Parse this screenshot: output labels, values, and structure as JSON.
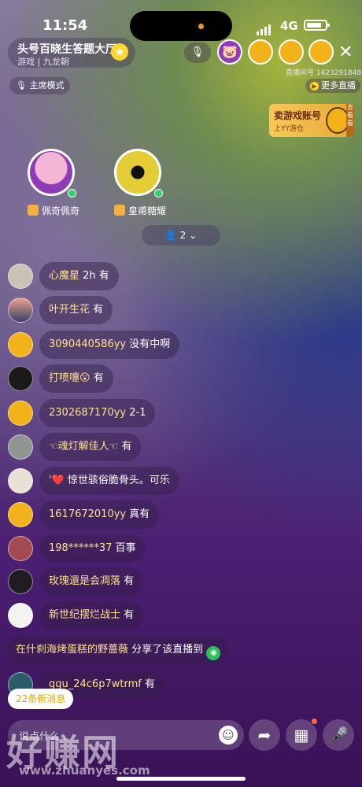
{
  "status_bar": {
    "time": "11:54",
    "network": "4G"
  },
  "room": {
    "title": "头号百晓生答题大厅",
    "subtitle": "游戏 | 九龙朝",
    "room_id": "直播间号 1423291848",
    "more_live": "更多直播",
    "host_mode": "主席模式"
  },
  "promo": {
    "title": "卖游戏账号",
    "subtitle": "上YY游仓",
    "side": "去看看"
  },
  "seats": [
    {
      "name": "佩奇佩奇"
    },
    {
      "name": "皇甫糖耀"
    }
  ],
  "audience_count": "2",
  "messages": [
    {
      "name": "心魔星",
      "text": "2h 有"
    },
    {
      "name": "叶开生花",
      "text": "有"
    },
    {
      "name": "3090440586yy",
      "text": "没有中啊"
    },
    {
      "name": "打喷嚏😮",
      "text": "有"
    },
    {
      "name": "2302687170yy",
      "text": "2-1"
    },
    {
      "name": "☜魂灯解佳人☜",
      "text": "有"
    },
    {
      "name": "'❤️",
      "text": "惊世骇俗脆骨头。可乐"
    },
    {
      "name": "1617672010yy",
      "text": "真有"
    },
    {
      "name": "198******37",
      "text": "百事"
    },
    {
      "name": "玫瑰還是会凋落",
      "text": "有"
    },
    {
      "name": "新世纪摆烂战士",
      "text": "有"
    },
    {
      "name": "ggu_24c6p7wtrmf",
      "text": "有"
    }
  ],
  "share": {
    "name": "在什刹海烤蛋糕的野蔷薇",
    "text": "分享了该直播到"
  },
  "new_messages": "22条新消息",
  "input": {
    "placeholder": "说点什么..."
  },
  "watermark": {
    "text": "好赚网",
    "url": "www.zhuanyes.com"
  },
  "colors": {
    "name_color": "#ffe28a",
    "badge_yellow": "#ffd62e",
    "online_green": "#2fd36b"
  }
}
